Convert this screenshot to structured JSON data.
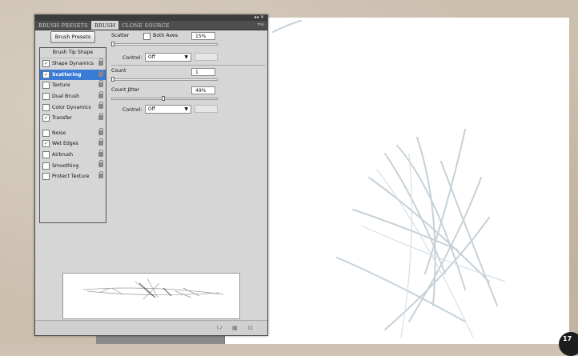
{
  "panel": {
    "tabs": [
      "BRUSH PRESETS",
      "BRUSH",
      "CLONE SOURCE"
    ],
    "active_tab": "BRUSH",
    "titlebar_controls": "◂◂ ✕",
    "menu_icon": "▾≡",
    "presets_button": "Brush Presets",
    "options_header": "Brush Tip Shape",
    "options": [
      {
        "label": "Shape Dynamics",
        "checked": true,
        "selected": false
      },
      {
        "label": "Scattering",
        "checked": true,
        "selected": true
      },
      {
        "label": "Texture",
        "checked": false,
        "selected": false
      },
      {
        "label": "Dual Brush",
        "checked": false,
        "selected": false
      },
      {
        "label": "Color Dynamics",
        "checked": false,
        "selected": false
      },
      {
        "label": "Transfer",
        "checked": true,
        "selected": false
      },
      {
        "label": "Noise",
        "checked": false,
        "selected": false
      },
      {
        "label": "Wet Edges",
        "checked": true,
        "selected": false
      },
      {
        "label": "Airbrush",
        "checked": false,
        "selected": false
      },
      {
        "label": "Smoothing",
        "checked": false,
        "selected": false
      },
      {
        "label": "Protect Texture",
        "checked": false,
        "selected": false
      }
    ],
    "scatter": {
      "label": "Scatter",
      "both_axes_label": "Both Axes",
      "both_axes_checked": false,
      "value": "15%",
      "slider_fraction": 0.0,
      "control_label": "Control:",
      "control_value": "Off"
    },
    "count": {
      "label": "Count",
      "value": "1",
      "slider_fraction": 0.0
    },
    "count_jitter": {
      "label": "Count Jitter",
      "value": "49%",
      "slider_fraction": 0.49,
      "control_label": "Control:",
      "control_value": "Off"
    },
    "bottom_icons": [
      "brush-icon",
      "grid-icon",
      "trash-icon"
    ],
    "bottom_icon_glyphs": [
      "⌇✓",
      "▦",
      "⊡"
    ]
  },
  "page_badge": "17",
  "colors": {
    "selected": "#3a7bd5",
    "canvas": "#ffffff",
    "workspace": "#8a8a8a"
  }
}
